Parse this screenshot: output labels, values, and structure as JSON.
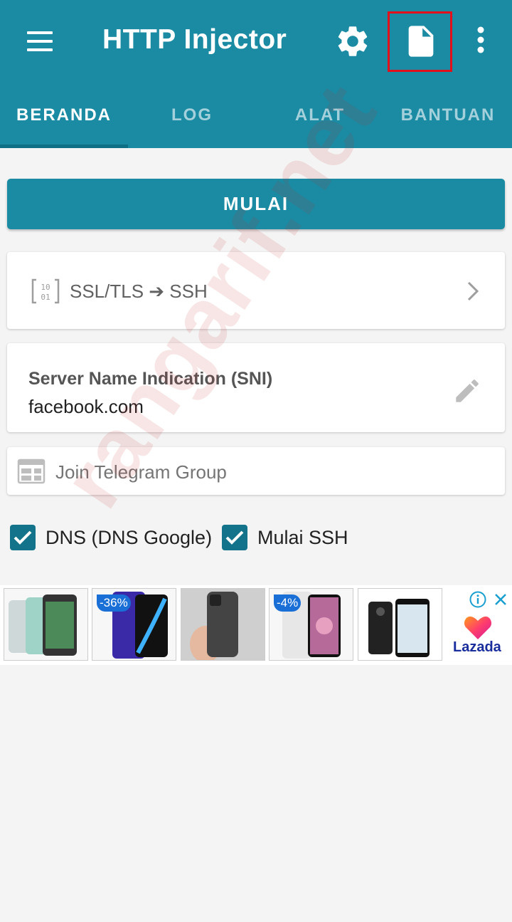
{
  "app": {
    "title": "HTTP Injector"
  },
  "tabs": [
    {
      "label": "BERANDA",
      "active": true
    },
    {
      "label": "LOG",
      "active": false
    },
    {
      "label": "ALAT",
      "active": false
    },
    {
      "label": "BANTUAN",
      "active": false
    }
  ],
  "main": {
    "start_button": "MULAI",
    "mode": {
      "label": "SSL/TLS ➔ SSH",
      "icon": "binary-icon"
    },
    "sni": {
      "title": "Server Name Indication (SNI)",
      "value": "facebook.com"
    },
    "telegram": {
      "label": "Join Telegram Group",
      "icon": "web-layout-icon"
    },
    "checkboxes": [
      {
        "label": "DNS (DNS Google)",
        "checked": true
      },
      {
        "label": "Mulai SSH",
        "checked": true
      }
    ]
  },
  "ad": {
    "brand": "Lazada",
    "items": [
      {
        "badge": ""
      },
      {
        "badge": "-36%"
      },
      {
        "badge": ""
      },
      {
        "badge": "-4%"
      },
      {
        "badge": ""
      }
    ]
  },
  "watermark": "rangarif.net",
  "colors": {
    "primary": "#1a8ba3",
    "checkbox": "#13738a",
    "highlight": "#e3101c"
  }
}
